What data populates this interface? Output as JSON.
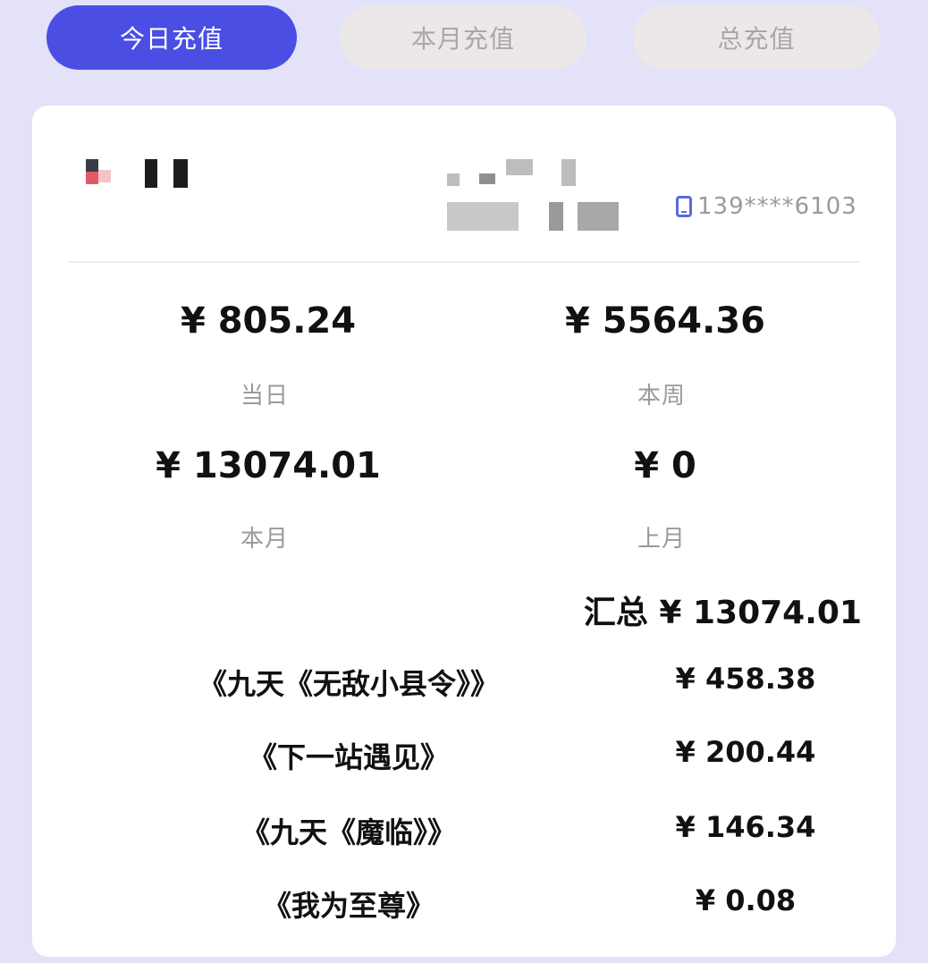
{
  "tabs": [
    {
      "label": "今日充值",
      "active": true
    },
    {
      "label": "本月充值",
      "active": false
    },
    {
      "label": "总充值",
      "active": false
    }
  ],
  "account": {
    "phone": "139****6103"
  },
  "stats": [
    {
      "value": "¥ 805.24",
      "label": "当日"
    },
    {
      "value": "¥ 5564.36",
      "label": "本周"
    },
    {
      "value": "¥ 13074.01",
      "label": "本月"
    },
    {
      "value": "¥ 0",
      "label": "上月"
    }
  ],
  "summary": {
    "text": "汇总 ¥ 13074.01"
  },
  "books": [
    {
      "title": "《九天《无敌小县令》》",
      "amount": "¥ 458.38"
    },
    {
      "title": "《下一站遇见》",
      "amount": "¥ 200.44"
    },
    {
      "title": "《九天《魔临》》",
      "amount": "¥ 146.34"
    },
    {
      "title": "《我为至尊》",
      "amount": "¥ 0.08"
    }
  ],
  "colors": {
    "accent": "#4a4ee3",
    "background": "#e3e2f8",
    "inactive_tab": "#ece8ea"
  }
}
